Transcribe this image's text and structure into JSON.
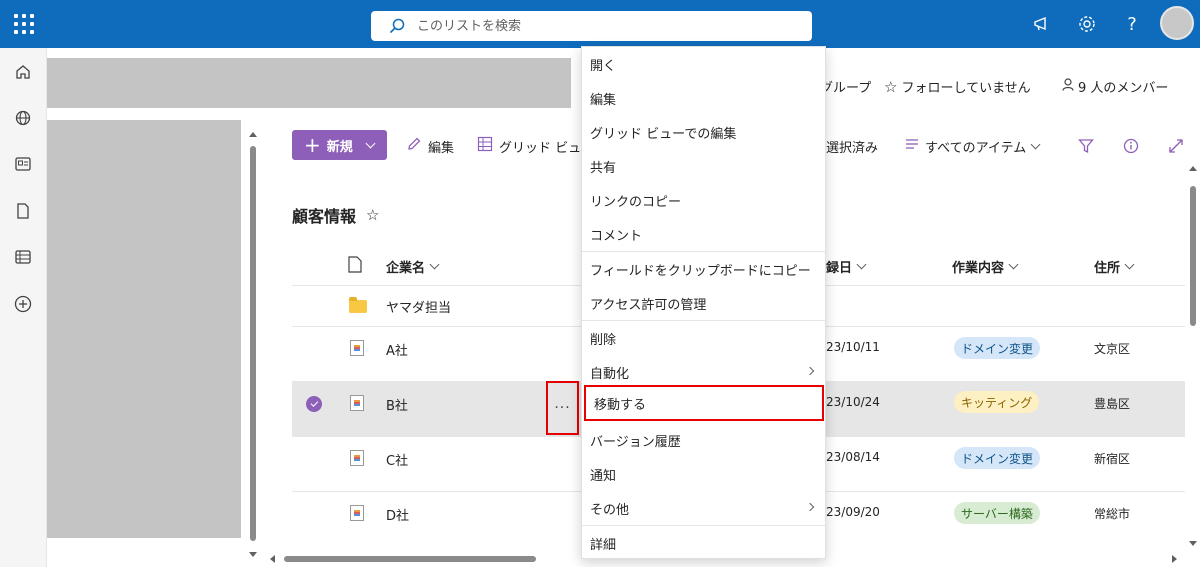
{
  "search": {
    "placeholder": "このリストを検索"
  },
  "header": {
    "group_label": "グループ",
    "follow_label": "フォローしていません",
    "members_label": "9 人のメンバー"
  },
  "commandbar": {
    "new_label": "新規",
    "edit_label": "編集",
    "grid_label": "グリッド ビュ",
    "selected_label": "選択済み",
    "view_label": "すべてのアイテム"
  },
  "list": {
    "title": "顧客情報",
    "columns": {
      "company": "企業名",
      "date": "録日",
      "work": "作業内容",
      "address": "住所"
    },
    "rows": [
      {
        "name": "ヤマダ担当",
        "date": "",
        "work": "",
        "address": ""
      },
      {
        "name": "A社",
        "date": "23/10/11",
        "work": "ドメイン変更",
        "address": "文京区"
      },
      {
        "name": "B社",
        "date": "23/10/24",
        "work": "キッティング",
        "address": "豊島区"
      },
      {
        "name": "C社",
        "date": "23/08/14",
        "work": "ドメイン変更",
        "address": "新宿区"
      },
      {
        "name": "D社",
        "date": "23/09/20",
        "work": "サーバー構築",
        "address": "常総市"
      }
    ],
    "more_label": "···"
  },
  "context_menu": {
    "items": [
      {
        "label": "開く"
      },
      {
        "label": "編集"
      },
      {
        "label": "グリッド ビューでの編集"
      },
      {
        "label": "共有"
      },
      {
        "label": "リンクのコピー"
      },
      {
        "label": "コメント"
      },
      {
        "label": "フィールドをクリップボードにコピー"
      },
      {
        "label": "アクセス許可の管理"
      },
      {
        "label": "削除"
      },
      {
        "label": "自動化"
      },
      {
        "label": "移動する"
      },
      {
        "label": "バージョン履歴"
      },
      {
        "label": "通知"
      },
      {
        "label": "その他"
      },
      {
        "label": "詳細"
      }
    ]
  },
  "colors": {
    "topbar": "#0f6cbd",
    "accent": "#8e5fb9",
    "highlight": "#e60000"
  },
  "icons": [
    "waffle-icon",
    "search-icon",
    "megaphone-icon",
    "gear-icon",
    "help-icon",
    "home-icon",
    "globe-icon",
    "news-icon",
    "document-icon",
    "list-icon",
    "add-circle-icon",
    "pencil-icon",
    "grid-icon",
    "star-icon",
    "person-icon",
    "filter-icon",
    "info-icon",
    "expand-icon"
  ]
}
